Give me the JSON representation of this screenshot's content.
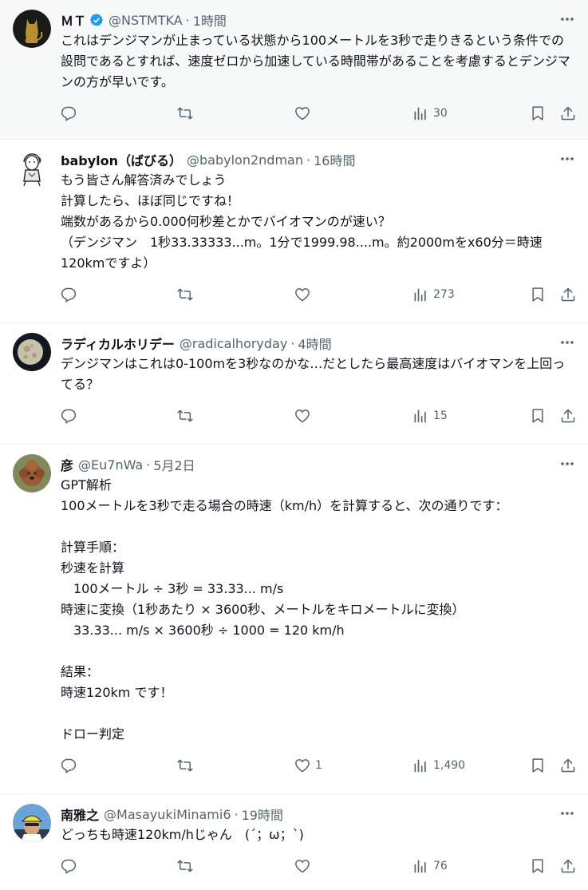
{
  "posts": [
    {
      "name": "ＭＴ",
      "verified": true,
      "handle": "@NSTMTKA",
      "time": "1時間",
      "text": "これはデンジマンが止まっている状態から100メートルを3秒で走りきるという条件での設問であるとすれば、速度ゼロから加速している時間帯があることを考慮するとデンジマンの方が早いです。",
      "views": "30",
      "likes": "",
      "avatar_icon": "cat-silhouette-icon"
    },
    {
      "name": "babylon（ばびる）",
      "verified": false,
      "handle": "@babylon2ndman",
      "time": "16時間",
      "text": "もう皆さん解答済みでしょう\n計算したら、ほぼ同じですね！\n端数があるから0.000何秒差とかでバイオマンのが速い？\n（デンジマン　1秒33.33333...m。1分で1999.98....m。約2000mをx60分＝時速120kmですよ）",
      "views": "273",
      "likes": "",
      "avatar_icon": "cartoon-character-icon"
    },
    {
      "name": "ラディカルホリデー",
      "verified": false,
      "handle": "@radicalhoryday",
      "time": "4時間",
      "text": "デンジマンはこれは0-100mを3秒なのかな…だとしたら最高速度はバイオマンを上回ってる？",
      "views": "15",
      "likes": "",
      "avatar_icon": "moon-icon"
    },
    {
      "name": "彦",
      "verified": false,
      "handle": "@Eu7nWa",
      "time": "5月2日",
      "text": "GPT解析\n100メートルを3秒で走る場合の時速（km/h）を計算すると、次の通りです：\n\n計算手順：\n秒速を計算\n　100メートル ÷ 3秒 = 33.33... m/s\n時速に変換（1秒あたり × 3600秒、メートルをキロメートルに変換）\n　33.33... m/s × 3600秒 ÷ 1000 = 120 km/h\n\n結果：\n時速120km です！\n\nドロー判定",
      "views": "1,490",
      "likes": "1",
      "avatar_icon": "poodle-dog-icon"
    },
    {
      "name": "南雅之",
      "verified": false,
      "handle": "@MasayukiMinami6",
      "time": "19時間",
      "text": "どっちも時速120km/hじゃん　(´；ω；`)",
      "views": "76",
      "likes": "",
      "avatar_icon": "cyclist-helmet-icon"
    }
  ],
  "separator": "·",
  "colors": {
    "text": "#0f1419",
    "secondary": "#536471",
    "verified": "#1d9bf0",
    "highlight_bg": "#f7f9f9",
    "divider": "#eff3f4"
  }
}
